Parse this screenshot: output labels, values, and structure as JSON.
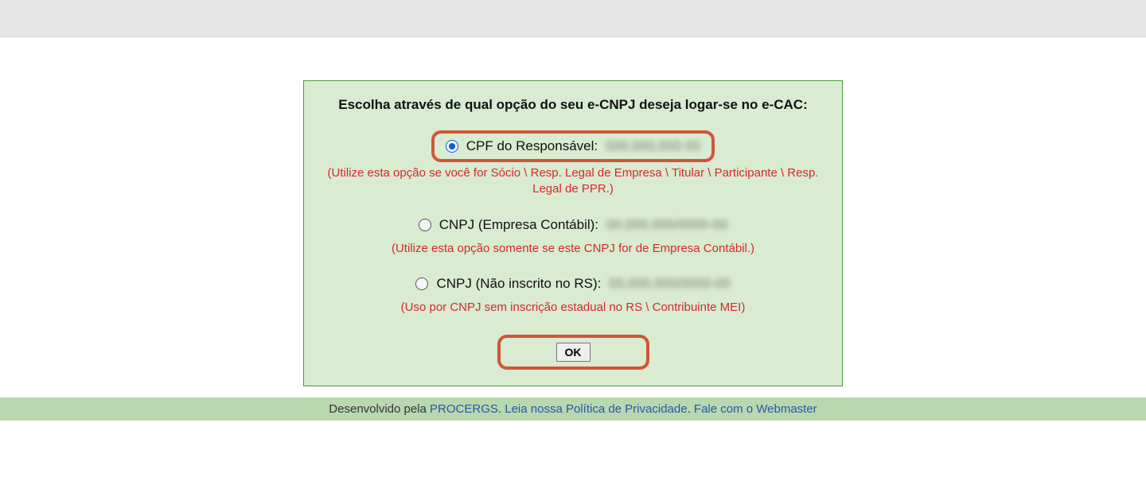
{
  "panel": {
    "heading": "Escolha através de qual opção do seu e-CNPJ deseja logar-se no e-CAC:",
    "options": [
      {
        "label": "CPF do Responsável:",
        "value_masked": "000.000.000-00",
        "help": "(Utilize esta opção se você for Sócio \\ Resp. Legal de Empresa \\ Titular \\ Participante \\ Resp. Legal de PPR.)",
        "checked": true,
        "highlighted": true
      },
      {
        "label": "CNPJ (Empresa Contábil):",
        "value_masked": "00.000.000/0000-00",
        "help": "(Utilize esta opção somente se este CNPJ for de Empresa Contábil.)",
        "checked": false,
        "highlighted": false
      },
      {
        "label": "CNPJ (Não inscrito no RS):",
        "value_masked": "00.000.000/0000-00",
        "help": "(Uso por CNPJ sem inscrição estadual no RS \\ Contribuinte MEI)",
        "checked": false,
        "highlighted": false
      }
    ],
    "ok_label": "OK"
  },
  "footer": {
    "prefix": "Desenvolvido pela ",
    "link1": "PROCERGS",
    "sep1": ". ",
    "link2": "Leia nossa Política de Privacidade",
    "sep2": ". ",
    "link3": "Fale com o Webmaster"
  }
}
